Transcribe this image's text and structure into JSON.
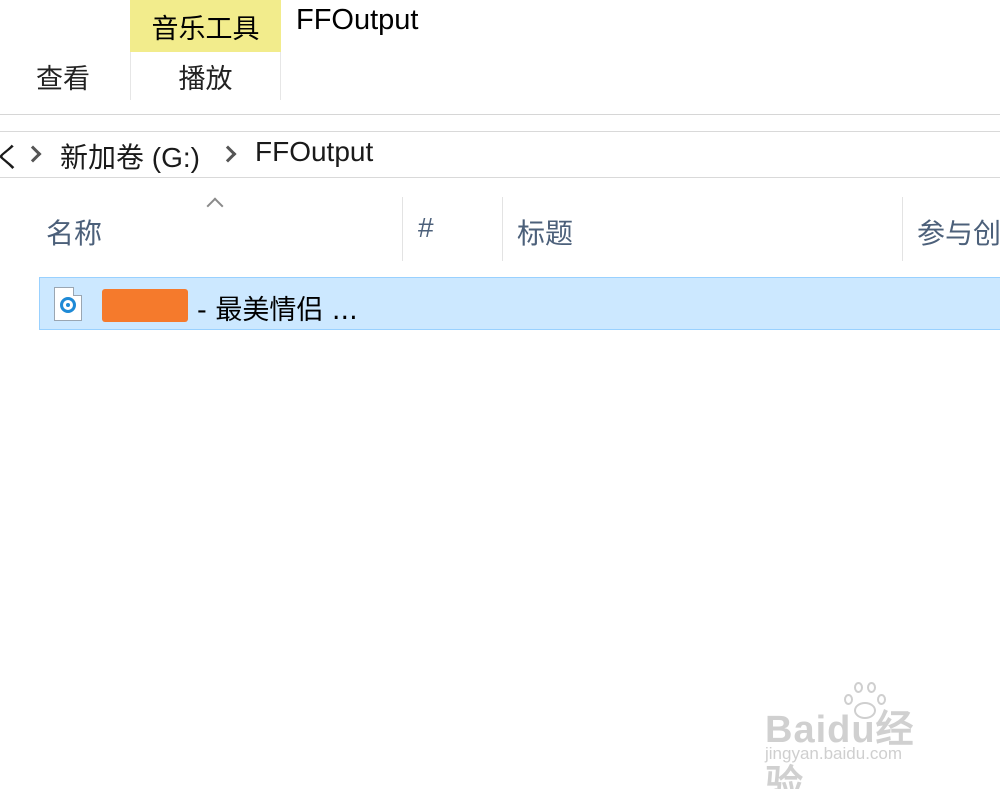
{
  "ribbon": {
    "context_tab": "音乐工具",
    "window_title": "FFOutput",
    "tabs": [
      {
        "label": "查看"
      },
      {
        "label": "播放"
      }
    ]
  },
  "address_bar": {
    "truncated": "く",
    "crumbs": [
      "新加卷 (G:)",
      "FFOutput"
    ]
  },
  "columns": {
    "name": "名称",
    "number": "#",
    "title": "标题",
    "artist": "参与创"
  },
  "files": [
    {
      "name_suffix": "- 最美情侣 ...",
      "icon": "audio-file-icon",
      "name_redacted": true,
      "selected": true
    }
  ],
  "watermark": {
    "brand": "Baidu经验",
    "url": "jingyan.baidu.com"
  },
  "colors": {
    "context_tab_bg": "#f2ec8c",
    "selection_bg": "#cce8ff",
    "selection_border": "#99d1ff",
    "header_text": "#4c607a",
    "redaction": "#f57a2c"
  }
}
